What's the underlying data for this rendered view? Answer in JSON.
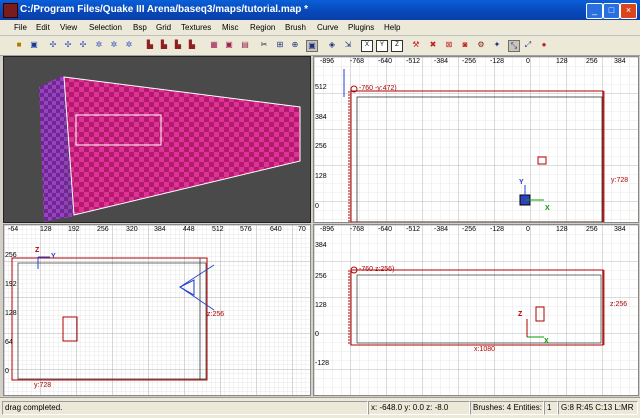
{
  "window": {
    "title": "C:/Program Files/Quake III Arena/baseq3/maps/tutorial.map *"
  },
  "window_buttons": {
    "minimize": "_",
    "maximize": "□",
    "close": "×"
  },
  "menu": [
    "File",
    "Edit",
    "View",
    "Selection",
    "Bsp",
    "Grid",
    "Textures",
    "Misc",
    "Region",
    "Brush",
    "Curve",
    "Plugins",
    "Help"
  ],
  "toolbar_icons": [
    "open-icon",
    "save-icon",
    "flip-x-icon",
    "flip-y-icon",
    "flip-z-icon",
    "rotate-x-icon",
    "rotate-y-icon",
    "rotate-z-icon",
    "select-complete-icon",
    "select-touching-icon",
    "select-partial-icon",
    "select-inside-icon",
    "csg-subtract-icon",
    "csg-hollow-icon",
    "csg-merge-icon",
    "clipper-icon",
    "change-views-icon",
    "texture-lock-icon",
    "cubic-clip-icon",
    "camera-icon",
    "scale-x-icon",
    "scale-y-icon",
    "scale-z-icon",
    "patch-icon",
    "patch-bend-icon",
    "patch-insert-icon",
    "patch-delete-icon",
    "entity-icon",
    "plugin-icon",
    "brush-icon",
    "move-icon",
    "lock-icon",
    "settings-icon"
  ],
  "toolbar_boxed_labels": {
    "x": "X",
    "y": "Y",
    "z": "Z"
  },
  "viewport_xy": {
    "x_ticks": [
      "-896",
      "-768",
      "-640",
      "-512",
      "-384",
      "-256",
      "-128",
      "0",
      "128",
      "256",
      "384"
    ],
    "y_ticks": [
      "512",
      "384",
      "256",
      "128",
      "0"
    ],
    "origin_label": "-760  -y:472)",
    "dim_label": "y:728",
    "axis_x": "X",
    "axis_y": "Y"
  },
  "viewport_yz": {
    "x_ticks": [
      "-64",
      "128",
      "192",
      "256",
      "320",
      "384",
      "448",
      "512",
      "576",
      "640",
      "70"
    ],
    "y_ticks": [
      "256",
      "192",
      "128",
      "64",
      "0"
    ],
    "dim_label_z": "z:256",
    "dim_label_y": "y:728",
    "axis_y": "Y",
    "axis_z": "Z"
  },
  "viewport_xz": {
    "x_ticks": [
      "-896",
      "-768",
      "-640",
      "-512",
      "-384",
      "-256",
      "-128",
      "0",
      "128",
      "256",
      "384"
    ],
    "y_ticks": [
      "384",
      "256",
      "128",
      "0",
      "-128"
    ],
    "origin_label": "-760  z:256)",
    "dim_label_z": "z:256",
    "dim_label_x": "x:1080",
    "axis_x": "X",
    "axis_z": "Z"
  },
  "status": {
    "message": "drag completed.",
    "coords": "x: -648.0  y: 0.0  z: -8.0",
    "counts": "Brushes: 4 Entities: 1",
    "misc": "1",
    "grid": "G:8 R:45 C:13 L:MR"
  },
  "colors": {
    "titlebar": "#0747b8",
    "brush": "#d42480",
    "selection": "#b00000"
  }
}
